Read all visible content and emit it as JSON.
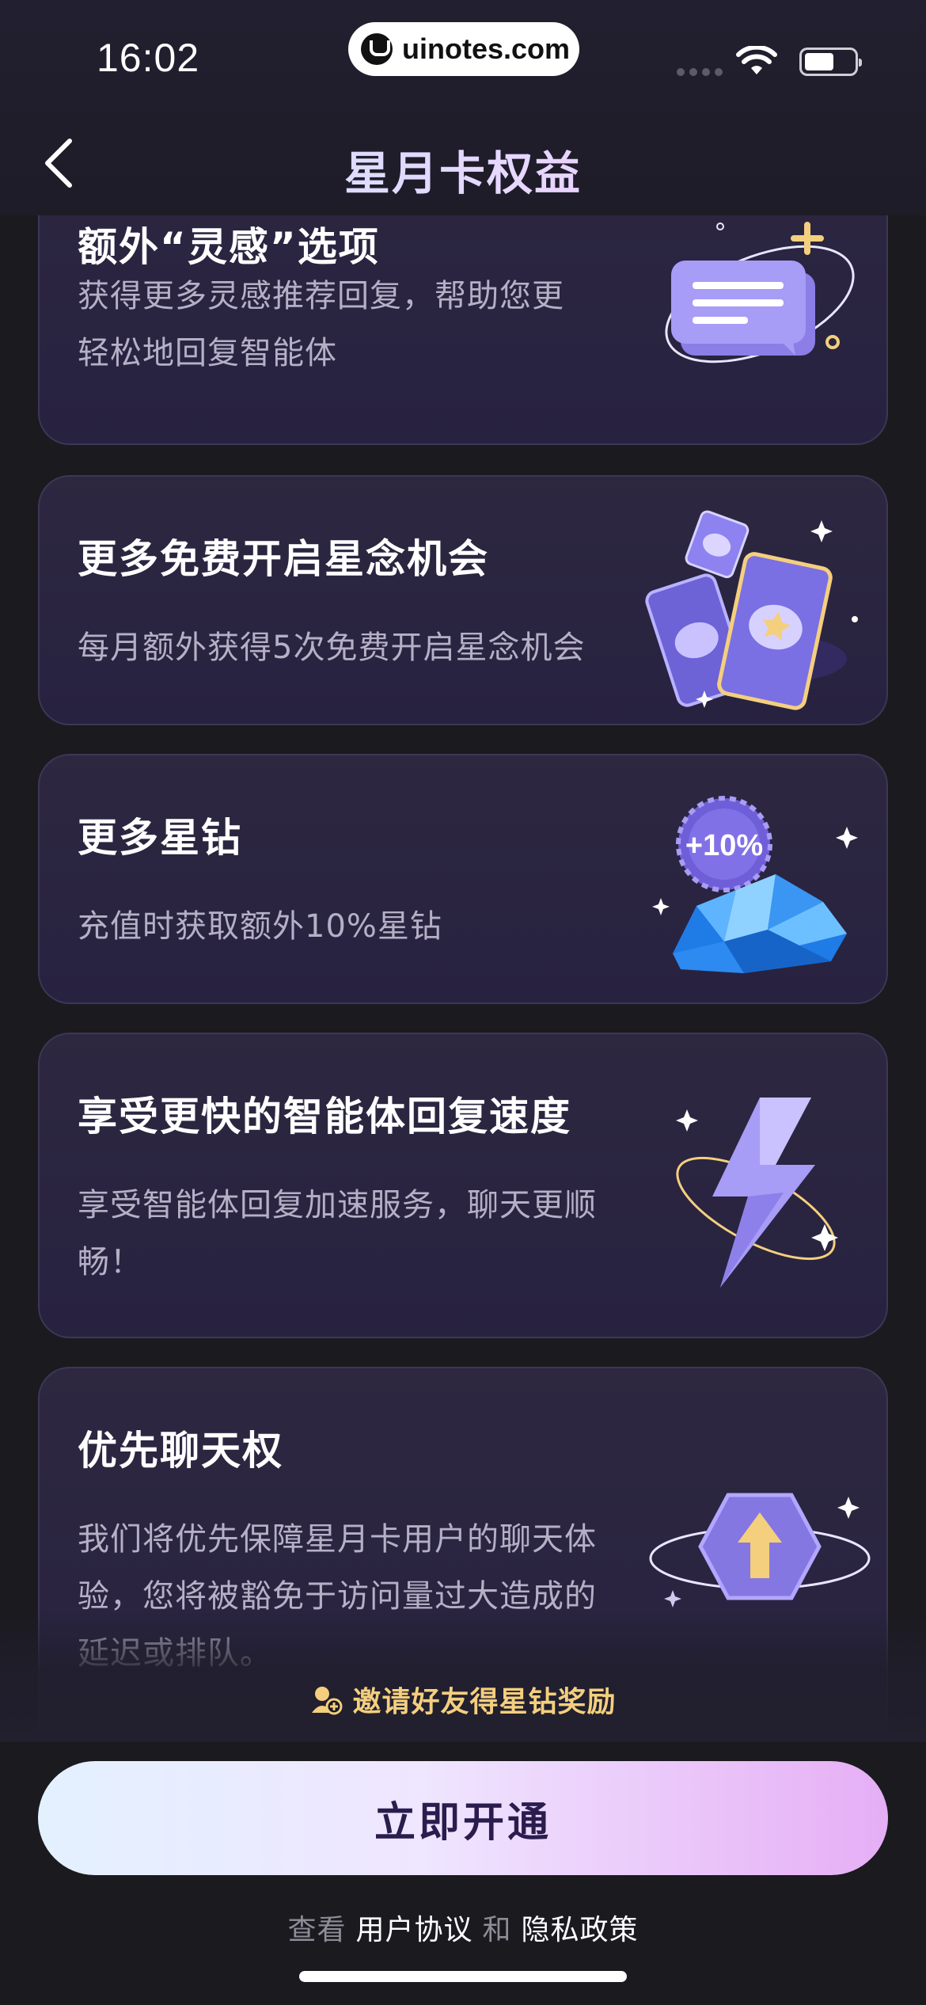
{
  "status_bar": {
    "time": "16:02",
    "url": "uinotes.com"
  },
  "header": {
    "title": "星月卡权益"
  },
  "benefits": [
    {
      "title": "额外“灵感”选项",
      "desc": "获得更多灵感推荐回复，帮助您更轻松地回复智能体",
      "icon": "chat-bubbles-icon"
    },
    {
      "title": "更多免费开启星念机会",
      "desc": "每月额外获得5次免费开启星念机会",
      "icon": "cards-icon"
    },
    {
      "title": "更多星钻",
      "desc": "充值时获取额外10%星钻",
      "badge": "+10%",
      "icon": "diamond-pile-icon"
    },
    {
      "title": "享受更快的智能体回复速度",
      "desc": "享受智能体回复加速服务，聊天更顺畅！",
      "icon": "lightning-icon"
    },
    {
      "title": "优先聊天权",
      "desc": "我们将优先保障星月卡用户的聊天体验，您将被豁免于访问量过大造成的延迟或排队。",
      "icon": "priority-arrow-icon"
    }
  ],
  "invite": {
    "label": "邀请好友得星钻奖励"
  },
  "cta": {
    "label": "立即开通"
  },
  "agreement": {
    "prefix": "查看",
    "user_agreement": "用户协议",
    "and": "和",
    "privacy_policy": "隐私政策"
  },
  "colors": {
    "background": "#1b1a1f",
    "card": "#2a2440",
    "invite": "#f4cf7e",
    "cta_text": "#2a1d4d"
  }
}
